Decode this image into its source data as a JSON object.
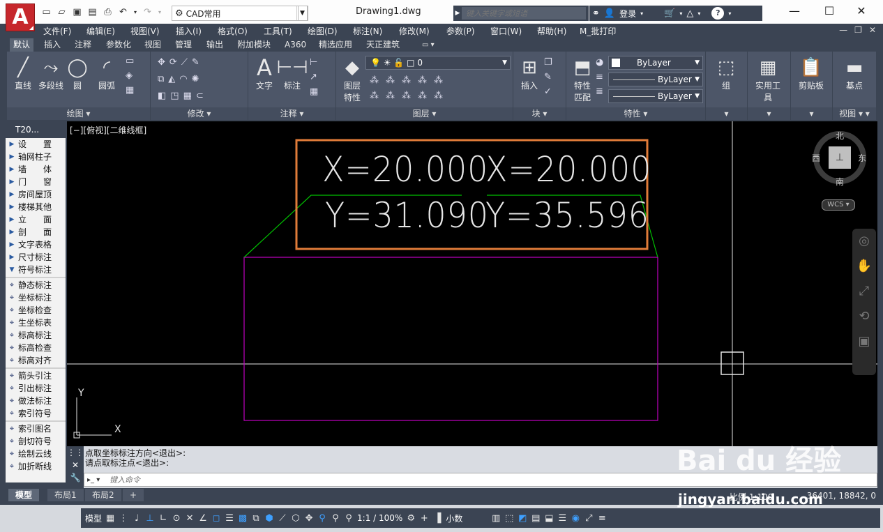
{
  "titlebar": {
    "logo": "A",
    "workspace": "CAD常用",
    "document_title": "Drawing1.dwg",
    "search_placeholder": "键入关键字或短语",
    "login": "登录"
  },
  "menu": [
    "文件(F)",
    "编辑(E)",
    "视图(V)",
    "插入(I)",
    "格式(O)",
    "工具(T)",
    "绘图(D)",
    "标注(N)",
    "修改(M)",
    "参数(P)",
    "窗口(W)",
    "帮助(H)",
    "M_批打印"
  ],
  "ribbon_tabs": [
    "默认",
    "插入",
    "注释",
    "参数化",
    "视图",
    "管理",
    "输出",
    "附加模块",
    "A360",
    "精选应用",
    "天正建筑"
  ],
  "ribbon": {
    "draw": {
      "title": "绘图",
      "line": "直线",
      "polyline": "多段线",
      "circle": "圆",
      "arc": "圆弧"
    },
    "modify": {
      "title": "修改"
    },
    "annotation": {
      "title": "注释",
      "text": "文字",
      "dimension": "标注"
    },
    "layers": {
      "title": "图层",
      "layer_props": "图层\n特性",
      "current_layer": "0"
    },
    "block": {
      "title": "块",
      "insert": "插入"
    },
    "properties": {
      "title": "特性",
      "match": "特性\n匹配",
      "color": "ByLayer",
      "linetype": "ByLayer",
      "lineweight": "ByLayer"
    },
    "group": {
      "label": "组"
    },
    "utilities": {
      "label": "实用工具"
    },
    "clipboard": {
      "label": "剪贴板"
    },
    "view": {
      "label": "基点",
      "title": "视图"
    }
  },
  "palette": {
    "title": "T20...",
    "items_group1": [
      "设　　置",
      "轴网柱子",
      "墙　　体",
      "门　　窗",
      "房间屋顶",
      "楼梯其他",
      "立　　面",
      "剖　　面",
      "文字表格",
      "尺寸标注",
      "符号标注"
    ],
    "items_group2": [
      "静态标注",
      "坐标标注",
      "坐标检查",
      "生坐标表",
      "标高标注",
      "标高检查",
      "标高对齐"
    ],
    "items_group3": [
      "箭头引注",
      "引出标注",
      "做法标注",
      "索引符号"
    ],
    "items_group4": [
      "索引图名",
      "剖切符号",
      "绘制云线",
      "加折断线"
    ]
  },
  "viewport": {
    "label": "[−][俯视][二维线框]",
    "annotation": {
      "left_x": "X=20.000",
      "left_y": "Y=31.090",
      "right_x": "X=20.000",
      "right_y": "Y=35.596"
    },
    "compass": {
      "north": "北",
      "south": "南",
      "east": "东",
      "west": "西"
    },
    "wcs": "WCS",
    "ucs_x": "X",
    "ucs_y": "Y"
  },
  "command": {
    "history": [
      "点取坐标标注方向<退出>:",
      "请点取标注点<退出>:"
    ],
    "placeholder": "键入命令"
  },
  "layout_tabs": [
    "模型",
    "布局1",
    "布局2"
  ],
  "status": {
    "scale": "比例 1:100",
    "coordinates": "36401, 18842, 0",
    "model": "模型",
    "annotation_scale": "1:1 / 100%",
    "units": "小数"
  },
  "watermark": {
    "brand": "Bai du 经验",
    "url": "jingyan.baidu.com"
  },
  "colors": {
    "accent_orange": "#e07b39",
    "green_leader": "#00c000",
    "magenta_rect": "#c000c0"
  }
}
